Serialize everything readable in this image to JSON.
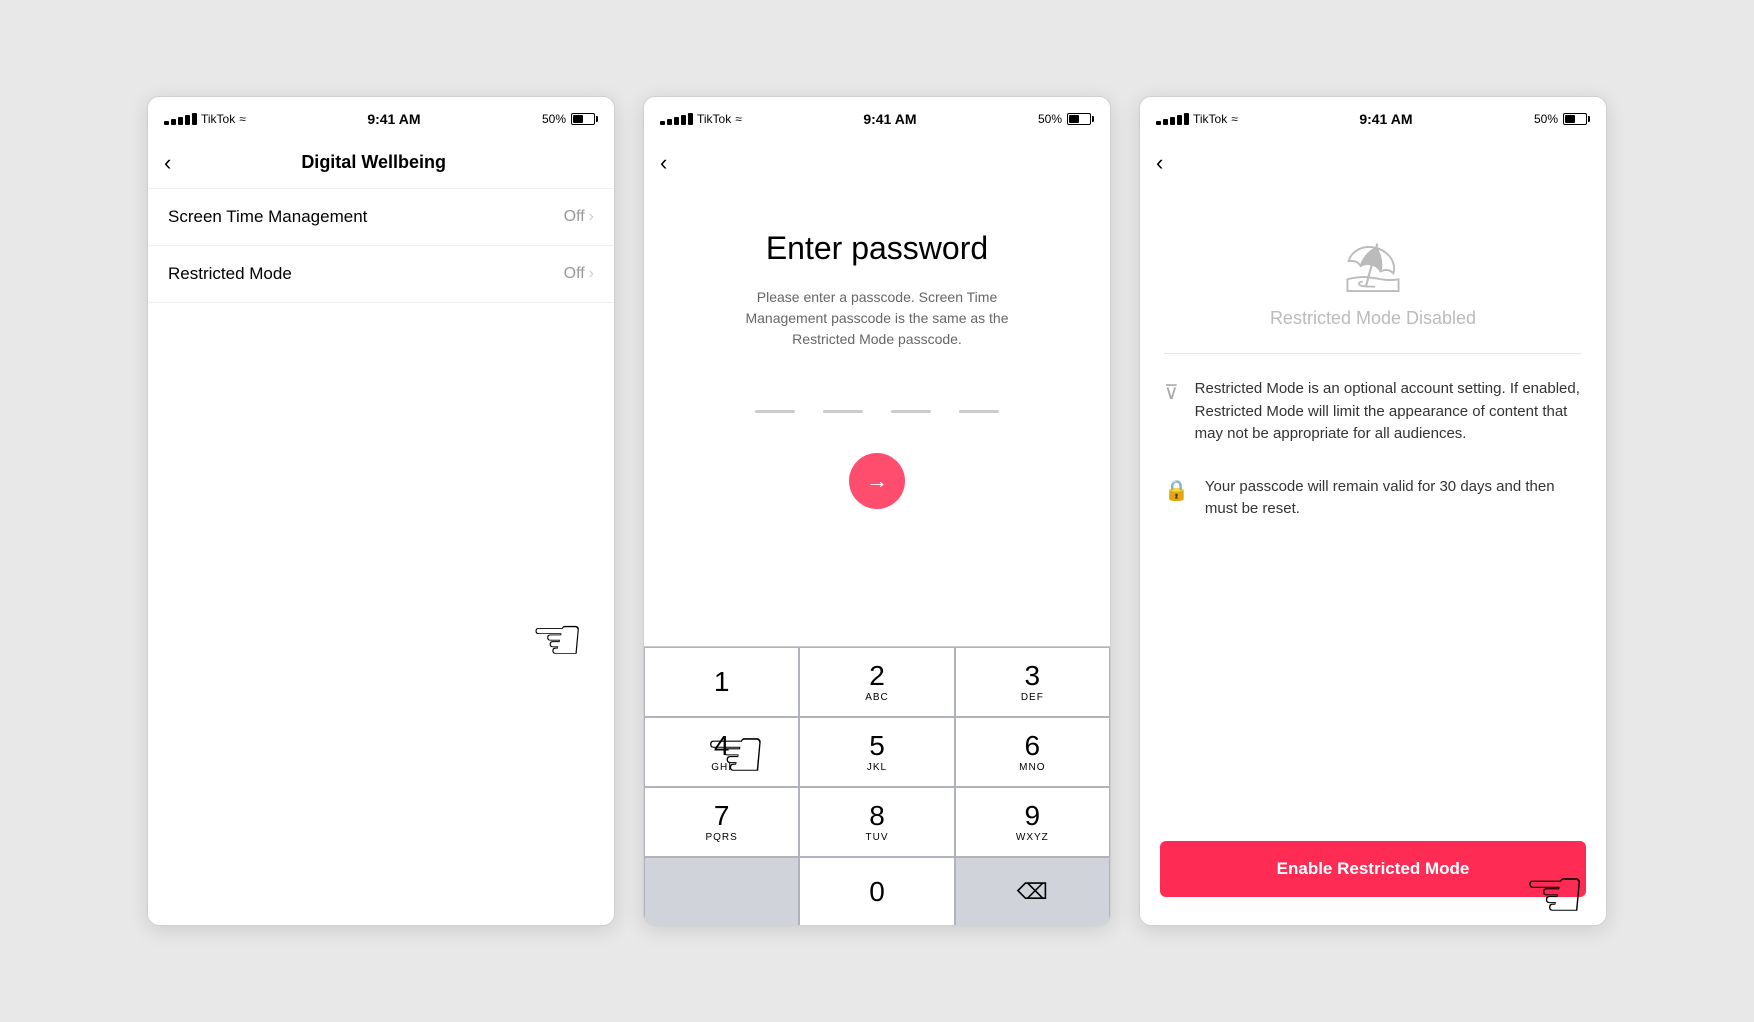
{
  "phones": {
    "status": {
      "carrier": "TikTok",
      "time": "9:41 AM",
      "battery": "50%"
    },
    "phone1": {
      "nav_title": "Digital Wellbeing",
      "back_label": "‹",
      "settings": [
        {
          "label": "Screen Time Management",
          "value": "Off",
          "has_arrow": true
        },
        {
          "label": "Restricted Mode",
          "value": "Off",
          "has_arrow": true
        }
      ]
    },
    "phone2": {
      "back_label": "‹",
      "title": "Enter password",
      "subtitle": "Please enter a passcode. Screen Time Management passcode is the same as the Restricted Mode passcode.",
      "keyboard": {
        "rows": [
          [
            {
              "num": "1",
              "letters": ""
            },
            {
              "num": "2",
              "letters": "ABC"
            },
            {
              "num": "3",
              "letters": "DEF"
            }
          ],
          [
            {
              "num": "4",
              "letters": "GHI"
            },
            {
              "num": "5",
              "letters": "JKL"
            },
            {
              "num": "6",
              "letters": "MNO"
            }
          ],
          [
            {
              "num": "7",
              "letters": "PQRS"
            },
            {
              "num": "8",
              "letters": "TUV"
            },
            {
              "num": "9",
              "letters": "WXYZ"
            }
          ]
        ],
        "zero": "0"
      }
    },
    "phone3": {
      "back_label": "‹",
      "mode_title": "Restricted Mode Disabled",
      "info_items": [
        {
          "text": "Restricted Mode is an optional account setting. If enabled, Restricted Mode will limit the appearance of content that may not be appropriate for all audiences."
        },
        {
          "text": "Your passcode will remain valid for 30 days and then must be reset."
        }
      ],
      "enable_button": "Enable Restricted Mode"
    }
  }
}
